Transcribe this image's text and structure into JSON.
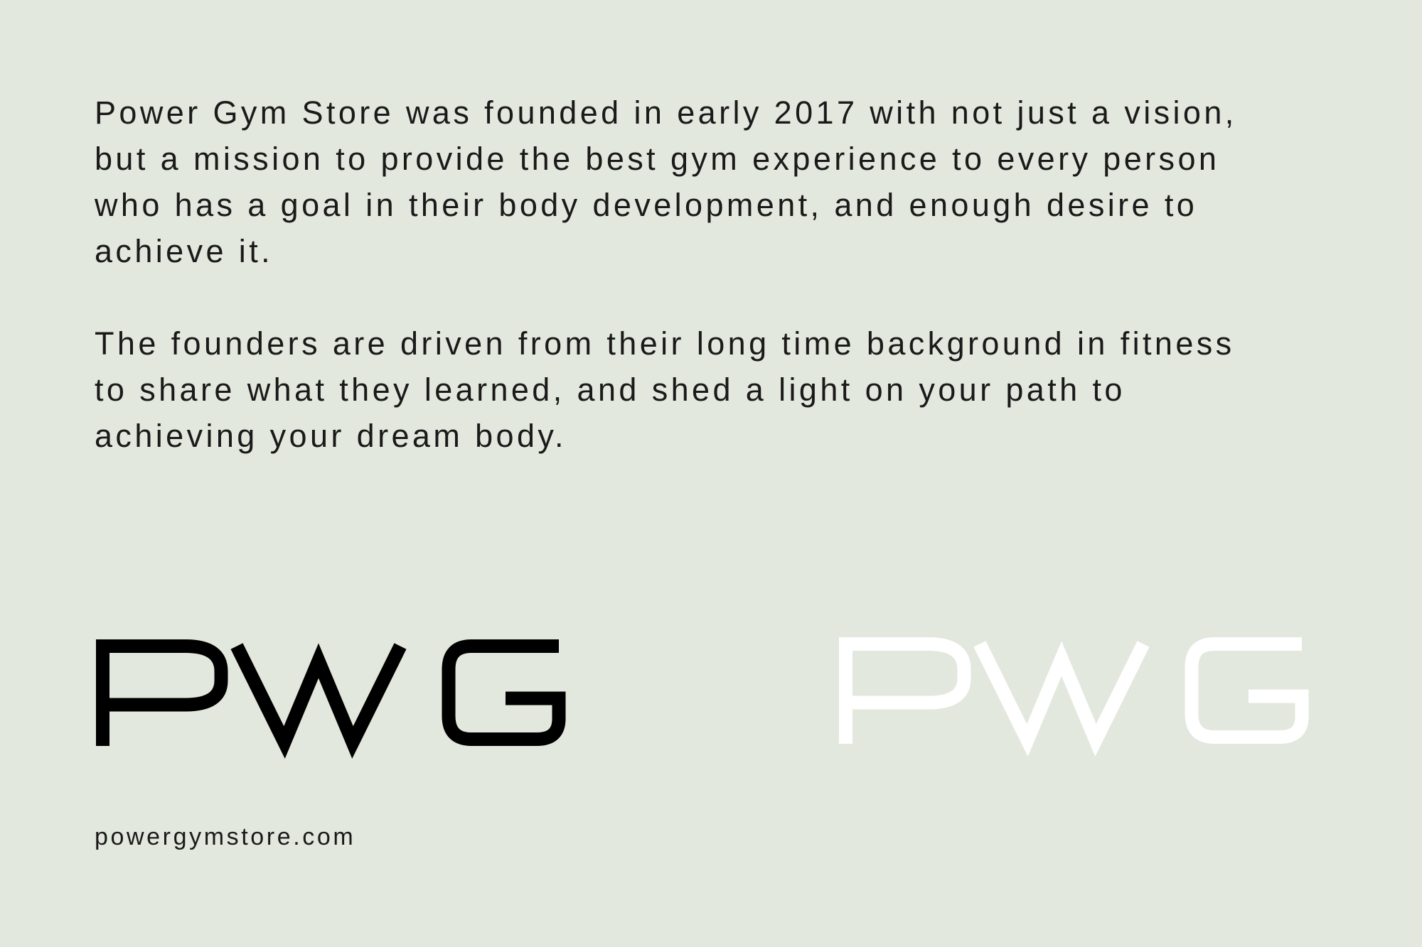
{
  "about": {
    "paragraph_1": "Power Gym Store was founded in early 2017 with not just a vision,\nbut a mission to provide the best gym experience to every person\nwho has a goal in their body development, and enough desire to\nachieve it.",
    "paragraph_2": "The founders are driven from their long time background in fitness\nto share what they learned, and shed a light on your path to\nachieving your dream body."
  },
  "brand": {
    "logo_text": "PWG",
    "logo_variants": [
      {
        "name": "dark-logo",
        "color": "#000000"
      },
      {
        "name": "light-logo",
        "color": "#ffffff"
      }
    ],
    "website": "powergymstore.com",
    "background_color": "#e3e8de"
  }
}
